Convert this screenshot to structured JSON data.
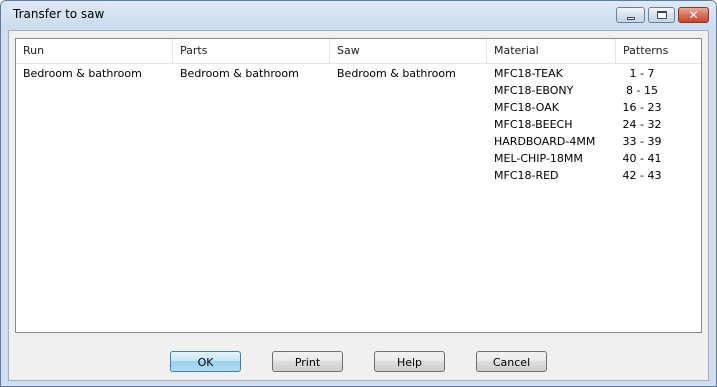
{
  "window": {
    "title": "Transfer to saw"
  },
  "table": {
    "columns": [
      "Run",
      "Parts",
      "Saw",
      "Material",
      "Patterns"
    ],
    "row": {
      "run": "Bedroom & bathroom",
      "parts": "Bedroom & bathroom",
      "saw": "Bedroom & bathroom"
    },
    "materials": [
      {
        "material": "MFC18-TEAK",
        "patterns": "1 - 7"
      },
      {
        "material": "MFC18-EBONY",
        "patterns": "8 - 15"
      },
      {
        "material": "MFC18-OAK",
        "patterns": "16 - 23"
      },
      {
        "material": "MFC18-BEECH",
        "patterns": "24 - 32"
      },
      {
        "material": "HARDBOARD-4MM",
        "patterns": "33 - 39"
      },
      {
        "material": "MEL-CHIP-18MM",
        "patterns": "40 - 41"
      },
      {
        "material": "MFC18-RED",
        "patterns": "42 - 43"
      }
    ]
  },
  "buttons": {
    "ok": "OK",
    "print": "Print",
    "help": "Help",
    "cancel": "Cancel"
  },
  "icons": {
    "minimize": "minimize-icon",
    "maximize": "maximize-icon",
    "close": "close-icon"
  }
}
